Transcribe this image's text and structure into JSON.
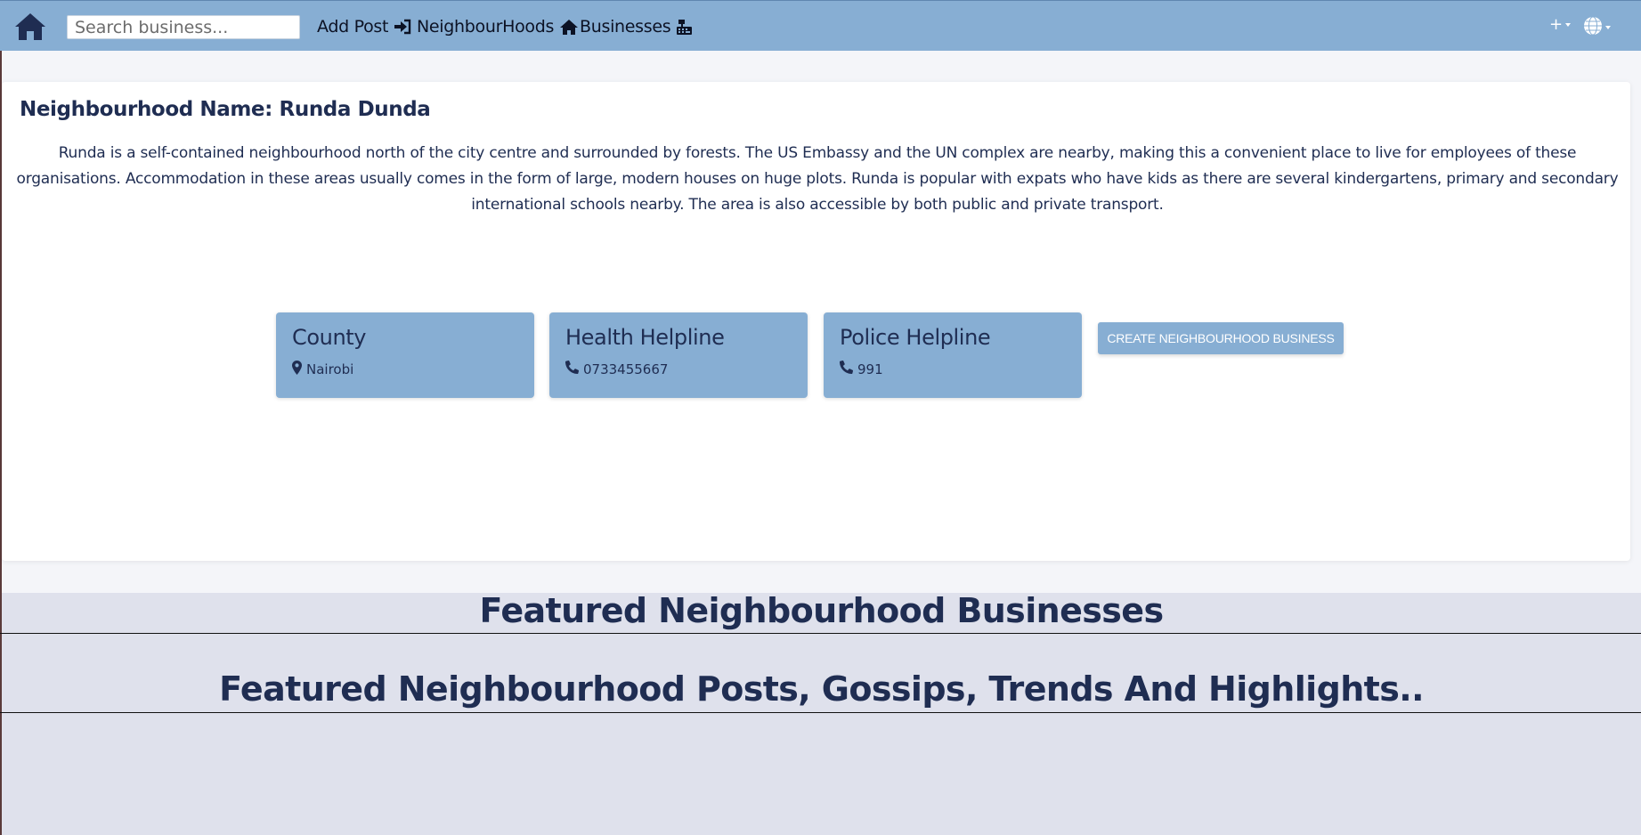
{
  "nav": {
    "search_placeholder": "Search business...",
    "links": [
      {
        "label": "Add Post",
        "icon": "sign-in-icon"
      },
      {
        "label": "NeighbourHoods",
        "icon": "home-icon"
      },
      {
        "label": "Businesses",
        "icon": "cash-register-icon"
      }
    ],
    "plus_label": "+"
  },
  "neighbourhood": {
    "title": "Neighbourhood Name: Runda Dunda",
    "description": "Runda is a self-contained neighbourhood north of the city centre and surrounded by forests. The US Embassy and the UN complex are nearby, making this a convenient place to live for employees of these organisations. Accommodation in these areas usually comes in the form of large, modern houses on huge plots. Runda is popular with expats who have kids as there are several kindergartens, primary and secondary international schools nearby. The area is also accessible by both public and private transport."
  },
  "info_boxes": [
    {
      "title": "County",
      "value": "Nairobi",
      "icon": "map-marker-icon"
    },
    {
      "title": "Health Helpline",
      "value": "0733455667",
      "icon": "phone-icon"
    },
    {
      "title": "Police Helpline",
      "value": "991",
      "icon": "phone-icon"
    }
  ],
  "create_button_label": "CREATE NEIGHBOURHOOD BUSINESS",
  "sections": {
    "businesses_heading": "Featured Neighbourhood Businesses",
    "posts_heading": "Featured Neighbourhood Posts, Gossips, Trends And Highlights.."
  },
  "colors": {
    "navbar": "#87aed3",
    "text_primary": "#1f2d52",
    "page_background": "#dfe1ec",
    "card_background": "#ffffff"
  }
}
